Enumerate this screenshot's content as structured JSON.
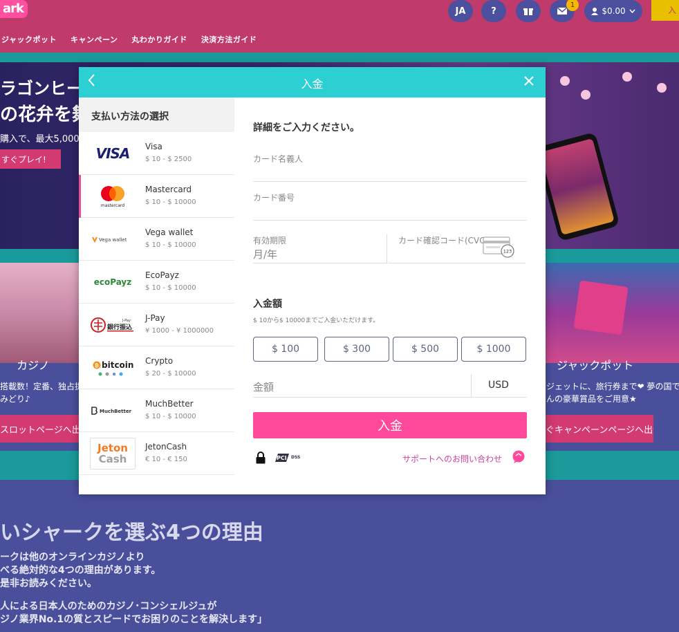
{
  "site": {
    "logo": "ark",
    "nav": [
      "ジャックポット",
      "キャンペーン",
      "丸わかりガイド",
      "決済方法ガイド"
    ],
    "header": {
      "lang": "JA",
      "help": "?",
      "mail_count": "1",
      "balance": "$0.00",
      "deposit_short": "入"
    },
    "hero": {
      "line1": "ラゴンヒーロ",
      "line2": "の花弁を舞",
      "line3": "購入で、最大5,000",
      "button": "すぐプレイ!"
    },
    "casino_label": "カジノ",
    "casino_text": [
      "搭載数！定番、独占提",
      "みどり♪"
    ],
    "casino_button": "スロットページへ出発",
    "jackpot_label": "ジャックポット",
    "jackpot_text": [
      "ジェットに、旅行券まで❤ 夢の国で",
      "んの豪華賞品をご用意★"
    ],
    "jackpot_button": "ぐキャンペーンページへ出発!",
    "reasons_title": "いシャークを選ぶ4つの理由",
    "reasons_p1": [
      "ークは他のオンラインカジノより",
      "べる絶対的な4つの理由があります。",
      "是非お読みください。"
    ],
    "reasons_p2": [
      "人による日本人のためのカジノ･コンシェルジュが",
      "ジノ業界No.1の質とスピードでお困りのことを解決します」"
    ]
  },
  "modal": {
    "title": "入金",
    "methods_header": "支払い方法の選択",
    "methods": [
      {
        "name": "Visa",
        "range": "$ 10 - $ 2500",
        "logo": "visa-logo",
        "active": false
      },
      {
        "name": "Mastercard",
        "range": "$ 10 - $ 10000",
        "logo": "mastercard-logo",
        "active": true
      },
      {
        "name": "Vega wallet",
        "range": "$ 10 - $ 10000",
        "logo": "vega-wallet-logo",
        "active": false
      },
      {
        "name": "EcoPayz",
        "range": "$ 10 - $ 10000",
        "logo": "ecopayz-logo",
        "active": false
      },
      {
        "name": "J-Pay",
        "range": "¥ 1000 - ¥ 1000000",
        "logo": "jpay-logo",
        "active": false
      },
      {
        "name": "Crypto",
        "range": "$ 20 - $ 10000",
        "logo": "bitcoin-logo",
        "active": false
      },
      {
        "name": "MuchBetter",
        "range": "$ 10 - $ 10000",
        "logo": "muchbetter-logo",
        "active": false
      },
      {
        "name": "JetonCash",
        "range": "€ 10 - € 150",
        "logo": "jetoncash-logo",
        "active": false
      }
    ],
    "logos": {
      "visa": "VISA",
      "mastercard": "mastercard",
      "vega": "Vega wallet",
      "ecopayz": "ecoPayz",
      "jpay_small": "J-Pay",
      "jpay_text": "銀行振込",
      "bitcoin": "bitcoin",
      "muchbetter": "MuchBetter",
      "jeton_1": "Jeton",
      "jeton_2": "Cash"
    },
    "form": {
      "heading": "詳細をご入力ください。",
      "cardholder_placeholder": "カード名義人",
      "cardnumber_placeholder": "カード番号",
      "expiry_label": "有効期限",
      "expiry_placeholder": "月/年",
      "cvc_label": "カード確認コード(CVC)",
      "cvc_icon_text": "123",
      "amount_heading": "入金額",
      "amount_sub": "$ 10から$ 10000までご入金いただけます。",
      "presets": [
        "$ 100",
        "$ 300",
        "$ 500",
        "$ 1000"
      ],
      "amount_placeholder": "金額",
      "currency": "USD",
      "submit": "入金",
      "pci": "PCI",
      "pci_dss": "DSS",
      "support": "サポートへのお問い合わせ"
    }
  },
  "colors": {
    "header_bg": "#c13a6c",
    "modal_head": "#2ccfd2",
    "accent_pink": "#ff4a9c",
    "page_bg": "#4a4f9c"
  }
}
